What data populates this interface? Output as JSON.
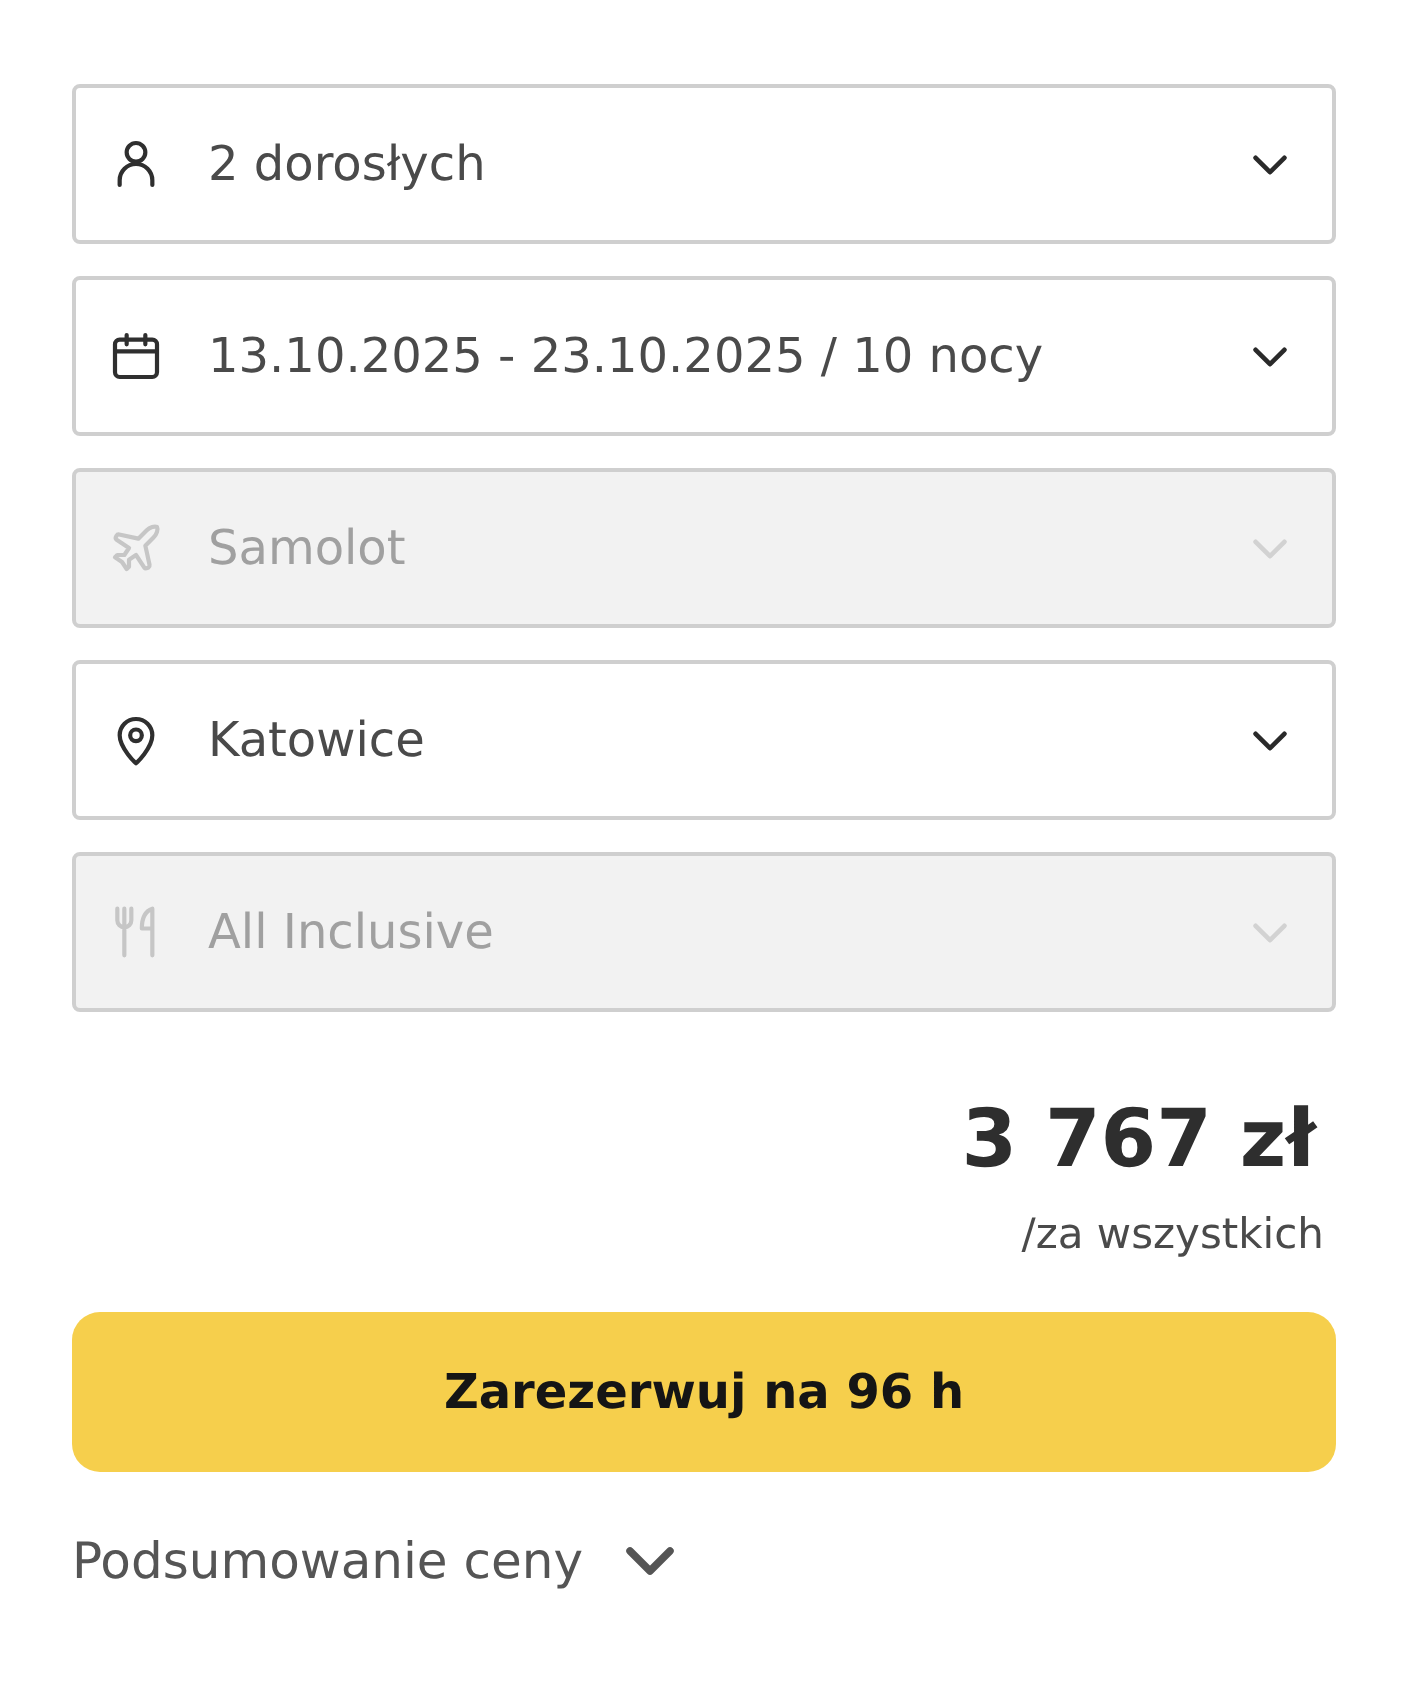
{
  "fields": [
    {
      "kind": "travelers",
      "value": "2 dorosłych",
      "disabled": false
    },
    {
      "kind": "dates",
      "value": "13.10.2025 - 23.10.2025 / 10 nocy",
      "disabled": false
    },
    {
      "kind": "transport",
      "value": "Samolot",
      "disabled": true
    },
    {
      "kind": "departure",
      "value": "Katowice",
      "disabled": false
    },
    {
      "kind": "board",
      "value": "All Inclusive",
      "disabled": true
    }
  ],
  "price": {
    "amount": "3 767 zł",
    "note": "/za wszystkich"
  },
  "book_button": {
    "label": "Zarezerwuj na 96 h"
  },
  "summary_toggle": {
    "label": "Podsumowanie ceny",
    "expanded": false
  }
}
